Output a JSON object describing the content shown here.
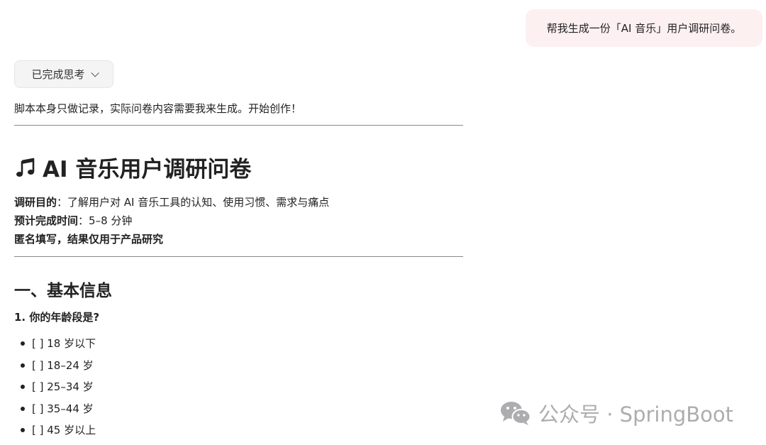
{
  "user_message": "帮我生成一份「AI 音乐」用户调研问卷。",
  "thinking": {
    "label": "已完成思考",
    "icon": "chevron-down-icon"
  },
  "intro_text": "脚本本身只做记录，实际问卷内容需要我来生成。开始创作！",
  "survey": {
    "title_icon": "music-note-icon",
    "title": "AI 音乐用户调研问卷",
    "purpose_label": "调研目的",
    "purpose_sep": "：",
    "purpose_value": "了解用户对 AI 音乐工具的认知、使用习惯、需求与痛点",
    "time_label": "预计完成时间",
    "time_sep": "：",
    "time_value": "5–8 分钟",
    "anonymous_note": "匿名填写，结果仅用于产品研究",
    "section1": {
      "heading": "一、基本信息",
      "question1": {
        "text": "1. 你的年龄段是?",
        "options": [
          "[ ] 18 岁以下",
          "[ ] 18–24 岁",
          "[ ] 25–34 岁",
          "[ ] 35–44 岁",
          "[ ] 45 岁以上"
        ]
      }
    }
  },
  "watermark": {
    "icon": "wechat-icon",
    "text": "公众号 · SpringBoot",
    "color": "#a9a9ac"
  },
  "colors": {
    "user_bubble_bg": "#fdf0f1",
    "pill_bg": "#f4f4f5",
    "text": "#222222",
    "divider": "#888888"
  }
}
